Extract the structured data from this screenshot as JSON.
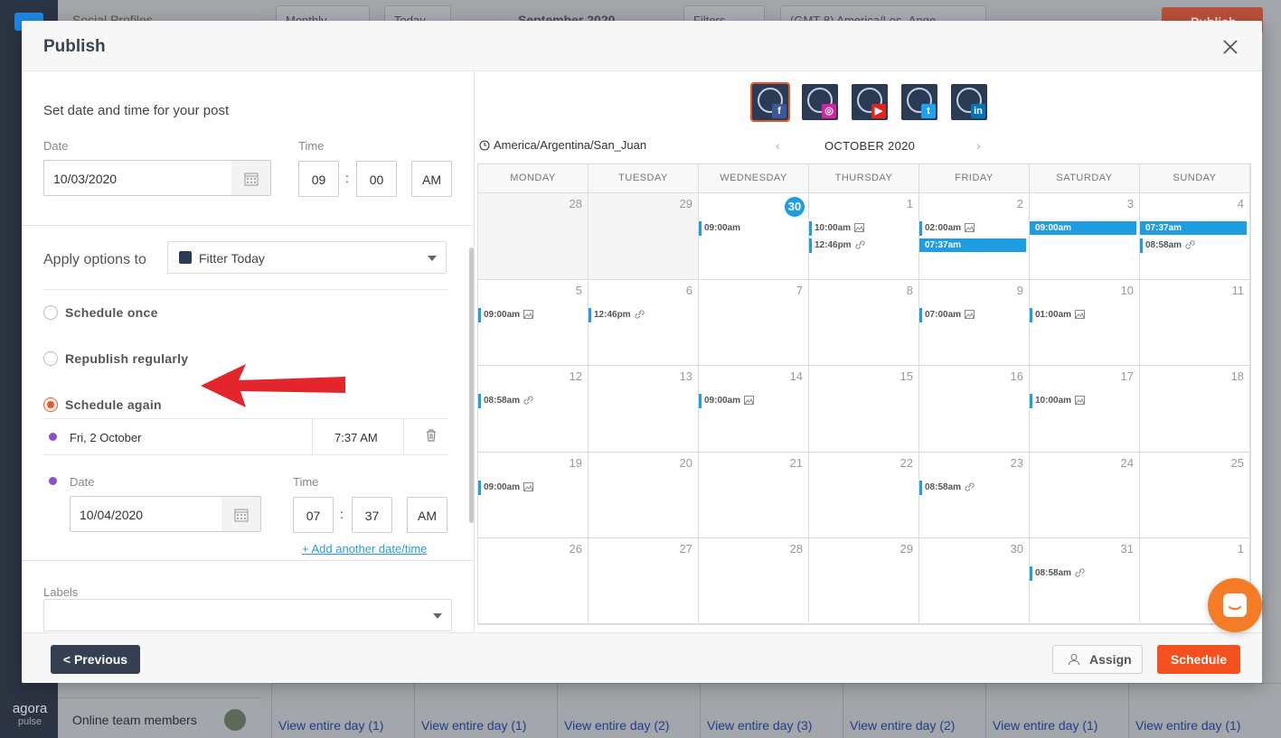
{
  "background": {
    "panel_title": "Social Profiles",
    "view_mode": "Monthly",
    "today_btn": "Today",
    "month": "September 2020",
    "filters": "Filters",
    "timezone": "(GMT-8) America/Los_Ange",
    "publish": "Publish",
    "online_team": "Online team members",
    "brand_top": "agora",
    "brand_bottom": "pulse",
    "view_links": [
      "View entire day (1)",
      "View entire day (1)",
      "View entire day (2)",
      "View entire day (3)",
      "View entire day (2)",
      "View entire day (1)",
      "View entire day (1)"
    ]
  },
  "modal": {
    "title": "Publish",
    "left": {
      "heading": "Set date and time for your post",
      "date_label": "Date",
      "date_value": "10/03/2020",
      "time_label": "Time",
      "hour": "09",
      "minute": "00",
      "ampm": "AM",
      "apply_label": "Apply options to",
      "apply_value": "Fitter Today",
      "options": [
        {
          "label": "Schedule once",
          "selected": false
        },
        {
          "label": "Republish regularly",
          "selected": false
        },
        {
          "label": "Schedule again",
          "selected": true
        }
      ],
      "again_entry": {
        "day": "Fri, 2 October",
        "time": "7:37 AM"
      },
      "second_date_label": "Date",
      "second_date_value": "10/04/2020",
      "second_time_label": "Time",
      "second_hour": "07",
      "second_minute": "37",
      "second_ampm": "AM",
      "add_link": "+ Add another date/time",
      "labels_label": "Labels",
      "colon": ":"
    },
    "right": {
      "networks": [
        "facebook",
        "instagram",
        "youtube",
        "twitter",
        "linkedin"
      ],
      "timezone": "America/Argentina/San_Juan",
      "month": "OCTOBER 2020",
      "weekdays": [
        "MONDAY",
        "TUESDAY",
        "WEDNESDAY",
        "THURSDAY",
        "FRIDAY",
        "SATURDAY",
        "SUNDAY"
      ],
      "weeks": [
        [
          {
            "day": "28",
            "other": true,
            "events": []
          },
          {
            "day": "29",
            "other": true,
            "events": []
          },
          {
            "day": "30",
            "today": true,
            "events": [
              {
                "time": "09:00am",
                "icon": ""
              }
            ]
          },
          {
            "day": "1",
            "events": [
              {
                "time": "10:00am",
                "icon": "image"
              },
              {
                "time": "12:46pm",
                "icon": "link"
              }
            ]
          },
          {
            "day": "2",
            "events": [
              {
                "time": "02:00am",
                "icon": "image"
              },
              {
                "time": "07:37am",
                "full": true
              }
            ]
          },
          {
            "day": "3",
            "events": [
              {
                "time": "09:00am",
                "full": true
              }
            ]
          },
          {
            "day": "4",
            "events": [
              {
                "time": "07:37am",
                "full": true
              },
              {
                "time": "08:58am",
                "icon": "link"
              }
            ]
          }
        ],
        [
          {
            "day": "5",
            "events": [
              {
                "time": "09:00am",
                "icon": "image"
              }
            ]
          },
          {
            "day": "6",
            "events": [
              {
                "time": "12:46pm",
                "icon": "link"
              }
            ]
          },
          {
            "day": "7",
            "events": []
          },
          {
            "day": "8",
            "events": []
          },
          {
            "day": "9",
            "events": [
              {
                "time": "07:00am",
                "icon": "image"
              }
            ]
          },
          {
            "day": "10",
            "events": [
              {
                "time": "01:00am",
                "icon": "image"
              }
            ]
          },
          {
            "day": "11",
            "events": []
          }
        ],
        [
          {
            "day": "12",
            "events": [
              {
                "time": "08:58am",
                "icon": "link"
              }
            ]
          },
          {
            "day": "13",
            "events": []
          },
          {
            "day": "14",
            "events": [
              {
                "time": "09:00am",
                "icon": "image"
              }
            ]
          },
          {
            "day": "15",
            "events": []
          },
          {
            "day": "16",
            "events": []
          },
          {
            "day": "17",
            "events": [
              {
                "time": "10:00am",
                "icon": "image"
              }
            ]
          },
          {
            "day": "18",
            "events": []
          }
        ],
        [
          {
            "day": "19",
            "events": [
              {
                "time": "09:00am",
                "icon": "image"
              }
            ]
          },
          {
            "day": "20",
            "events": []
          },
          {
            "day": "21",
            "events": []
          },
          {
            "day": "22",
            "events": []
          },
          {
            "day": "23",
            "events": [
              {
                "time": "08:58am",
                "icon": "link"
              }
            ]
          },
          {
            "day": "24",
            "events": []
          },
          {
            "day": "25",
            "events": []
          }
        ],
        [
          {
            "day": "26",
            "events": []
          },
          {
            "day": "27",
            "events": []
          },
          {
            "day": "28",
            "events": []
          },
          {
            "day": "29",
            "events": []
          },
          {
            "day": "30",
            "events": []
          },
          {
            "day": "31",
            "events": [
              {
                "time": "08:58am",
                "icon": "link"
              }
            ]
          },
          {
            "day": "1",
            "events": []
          }
        ]
      ]
    },
    "footer": {
      "previous": "< Previous",
      "assign": "Assign",
      "schedule": "Schedule"
    }
  },
  "colors": {
    "accent": "#f4511e",
    "calendar_event": "#1e9de0",
    "today": "#1e9de0",
    "entry_dot": "#8e4ec6"
  }
}
